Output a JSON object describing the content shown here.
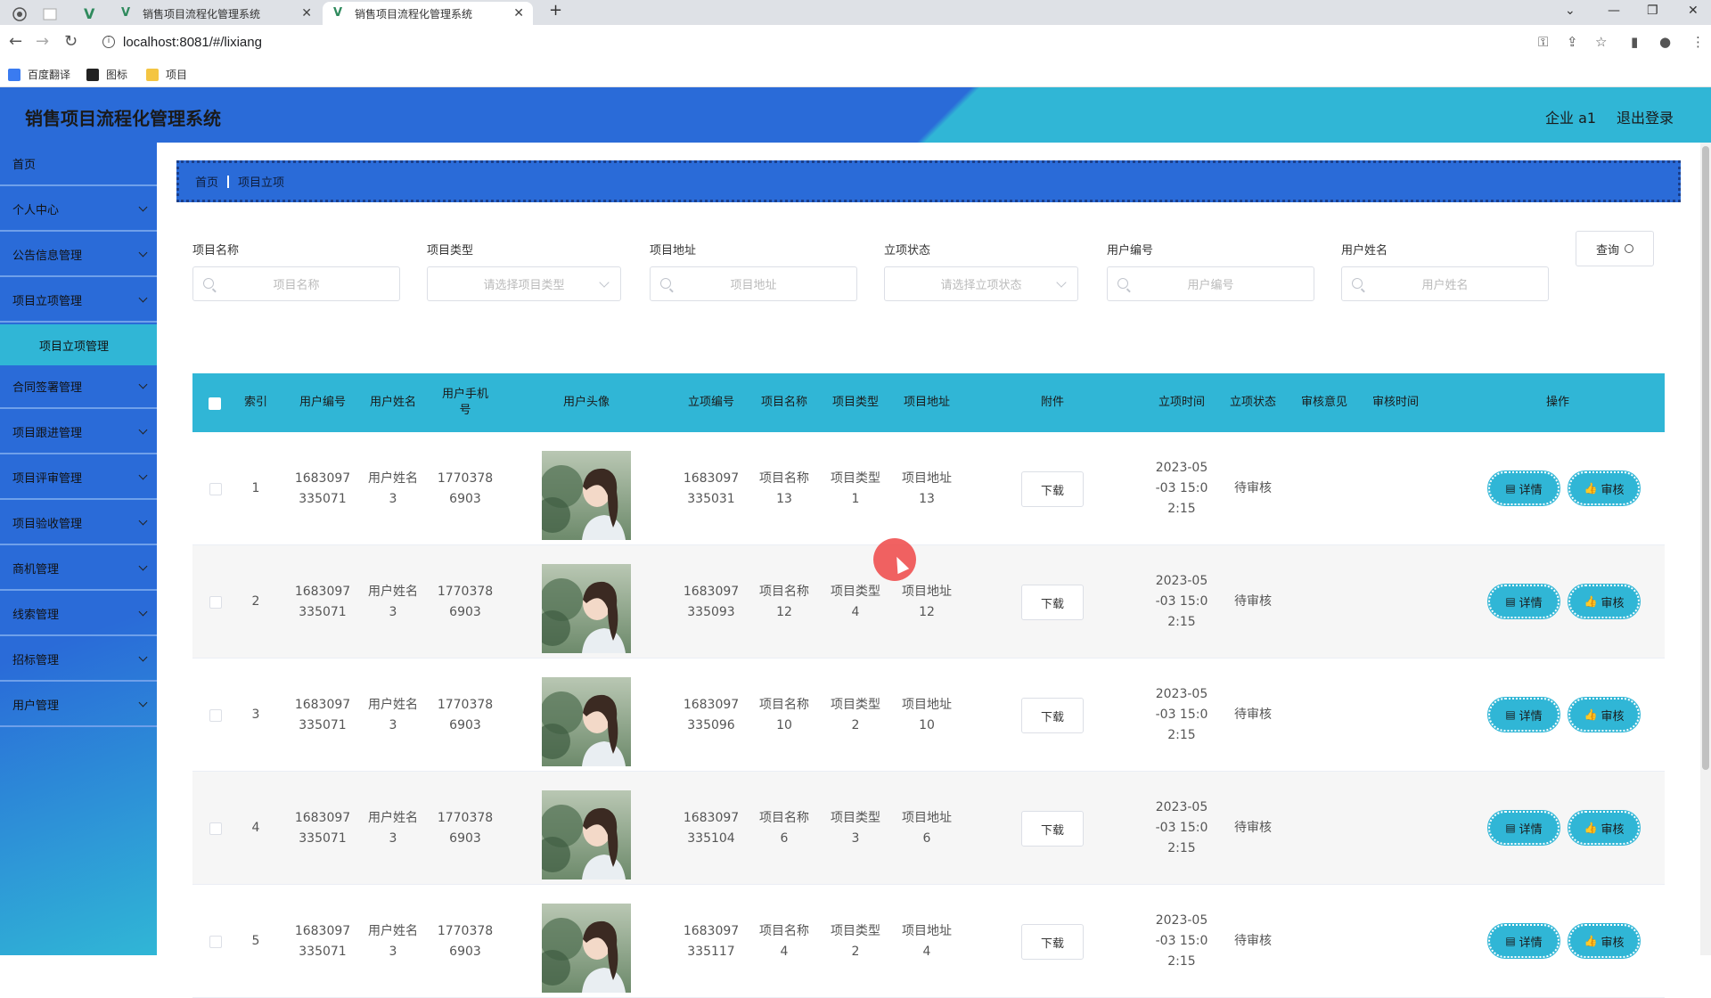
{
  "browser": {
    "tabs": [
      {
        "title": "销售项目流程化管理系统",
        "active": false
      },
      {
        "title": "销售项目流程化管理系统",
        "active": true
      }
    ],
    "new_tab": "+",
    "url": "localhost:8081/#/lixiang",
    "bookmarks": [
      {
        "label": "百度翻译",
        "color": "#3a7bf0"
      },
      {
        "label": "图标",
        "color": "#222222"
      },
      {
        "label": "项目",
        "color": "#f4c542"
      }
    ]
  },
  "header": {
    "title": "销售项目流程化管理系统",
    "user": "企业 a1",
    "logout": "退出登录"
  },
  "sidebar": {
    "items": [
      {
        "label": "首页",
        "has_children": false
      },
      {
        "label": "个人中心",
        "has_children": true
      },
      {
        "label": "公告信息管理",
        "has_children": true
      },
      {
        "label": "项目立项管理",
        "has_children": true
      },
      {
        "label": "合同签署管理",
        "has_children": true
      },
      {
        "label": "项目跟进管理",
        "has_children": true
      },
      {
        "label": "项目评审管理",
        "has_children": true
      },
      {
        "label": "项目验收管理",
        "has_children": true
      },
      {
        "label": "商机管理",
        "has_children": true
      },
      {
        "label": "线索管理",
        "has_children": true
      },
      {
        "label": "招标管理",
        "has_children": true
      },
      {
        "label": "用户管理",
        "has_children": true
      }
    ],
    "active_sub": "项目立项管理"
  },
  "breadcrumb": {
    "home": "首页",
    "current": "项目立项"
  },
  "filters": [
    {
      "label": "项目名称",
      "placeholder": "项目名称",
      "kind": "search"
    },
    {
      "label": "项目类型",
      "placeholder": "请选择项目类型",
      "kind": "select"
    },
    {
      "label": "项目地址",
      "placeholder": "项目地址",
      "kind": "search"
    },
    {
      "label": "立项状态",
      "placeholder": "请选择立项状态",
      "kind": "select"
    },
    {
      "label": "用户编号",
      "placeholder": "用户编号",
      "kind": "search"
    },
    {
      "label": "用户姓名",
      "placeholder": "用户姓名",
      "kind": "search"
    }
  ],
  "query_button": "查询",
  "table": {
    "columns": [
      "索引",
      "用户编号",
      "用户姓名",
      "用户手机\n号",
      "用户头像",
      "立项编号",
      "项目名称",
      "项目类型",
      "项目地址",
      "附件",
      "立项时间",
      "立项状态",
      "审核意见",
      "审核时间",
      "操作"
    ],
    "download_label": "下载",
    "detail_label": "详情",
    "audit_label": "审核",
    "rows": [
      {
        "index": "1",
        "user_no": "1683097\n335071",
        "user_name": "用户姓名\n3",
        "phone": "1770378\n6903",
        "project_no": "1683097\n335031",
        "project_name": "项目名称\n13",
        "project_type": "项目类型\n1",
        "project_addr": "项目地址\n13",
        "time": "2023-05\n-03 15:0\n2:15",
        "status": "待审核",
        "opinion": "",
        "audit_time": ""
      },
      {
        "index": "2",
        "user_no": "1683097\n335071",
        "user_name": "用户姓名\n3",
        "phone": "1770378\n6903",
        "project_no": "1683097\n335093",
        "project_name": "项目名称\n12",
        "project_type": "项目类型\n4",
        "project_addr": "项目地址\n12",
        "time": "2023-05\n-03 15:0\n2:15",
        "status": "待审核",
        "opinion": "",
        "audit_time": ""
      },
      {
        "index": "3",
        "user_no": "1683097\n335071",
        "user_name": "用户姓名\n3",
        "phone": "1770378\n6903",
        "project_no": "1683097\n335096",
        "project_name": "项目名称\n10",
        "project_type": "项目类型\n2",
        "project_addr": "项目地址\n10",
        "time": "2023-05\n-03 15:0\n2:15",
        "status": "待审核",
        "opinion": "",
        "audit_time": ""
      },
      {
        "index": "4",
        "user_no": "1683097\n335071",
        "user_name": "用户姓名\n3",
        "phone": "1770378\n6903",
        "project_no": "1683097\n335104",
        "project_name": "项目名称\n6",
        "project_type": "项目类型\n3",
        "project_addr": "项目地址\n6",
        "time": "2023-05\n-03 15:0\n2:15",
        "status": "待审核",
        "opinion": "",
        "audit_time": ""
      },
      {
        "index": "5",
        "user_no": "1683097\n335071",
        "user_name": "用户姓名\n3",
        "phone": "1770378\n6903",
        "project_no": "1683097\n335117",
        "project_name": "项目名称\n4",
        "project_type": "项目类型\n2",
        "project_addr": "项目地址\n4",
        "time": "2023-05\n-03 15:0\n2:15",
        "status": "待审核",
        "opinion": "",
        "audit_time": ""
      }
    ]
  },
  "colors": {
    "primary_blue": "#2a6bd8",
    "accent_cyan": "#30b6d6"
  }
}
